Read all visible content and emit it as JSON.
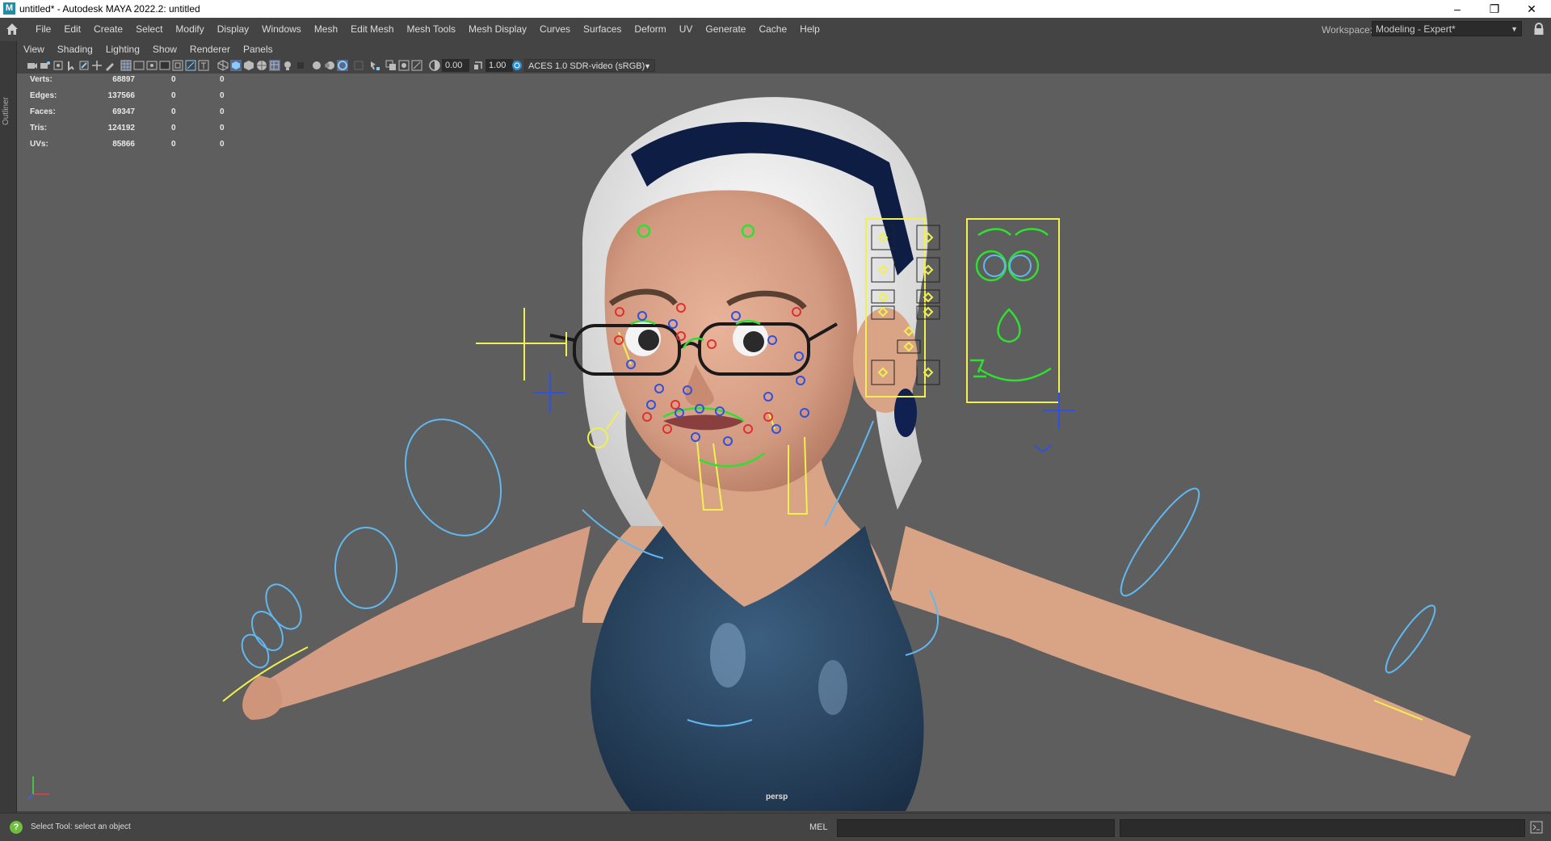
{
  "window": {
    "title": "untitled* - Autodesk MAYA 2022.2: untitled",
    "app_icon": "M",
    "controls": [
      "–",
      "❐",
      "✕"
    ]
  },
  "menubar": {
    "items": [
      "File",
      "Edit",
      "Create",
      "Select",
      "Modify",
      "Display",
      "Windows",
      "Mesh",
      "Edit Mesh",
      "Mesh Tools",
      "Mesh Display",
      "Curves",
      "Surfaces",
      "Deform",
      "UV",
      "Generate",
      "Cache",
      "Help"
    ],
    "workspace_label": "Workspace:",
    "workspace_value": "Modeling - Expert*"
  },
  "left_strip": {
    "outliner_label": "Outliner"
  },
  "panel_menu": {
    "items": [
      "View",
      "Shading",
      "Lighting",
      "Show",
      "Renderer",
      "Panels"
    ]
  },
  "toolbar": {
    "exposure": "0.00",
    "gamma": "1.00",
    "color_space": "ACES 1.0 SDR-video (sRGB)"
  },
  "hud": {
    "rows": [
      {
        "label": "Verts:",
        "v1": "68897",
        "v2": "0",
        "v3": "0"
      },
      {
        "label": "Edges:",
        "v1": "137566",
        "v2": "0",
        "v3": "0"
      },
      {
        "label": "Faces:",
        "v1": "69347",
        "v2": "0",
        "v3": "0"
      },
      {
        "label": "Tris:",
        "v1": "124192",
        "v2": "0",
        "v3": "0"
      },
      {
        "label": "UVs:",
        "v1": "85866",
        "v2": "0",
        "v3": "0"
      }
    ]
  },
  "viewport": {
    "camera": "persp"
  },
  "statusbar": {
    "help_text": "Select Tool: select an object",
    "mel_label": "MEL"
  },
  "colors": {
    "ui_bg": "#444444",
    "viewport_bg": "#5e5e5e",
    "rig_yellow": "#f0f050",
    "rig_green": "#30e030",
    "rig_blue": "#3050e0",
    "rig_cyan": "#60b8f0",
    "rig_red": "#e03030"
  }
}
